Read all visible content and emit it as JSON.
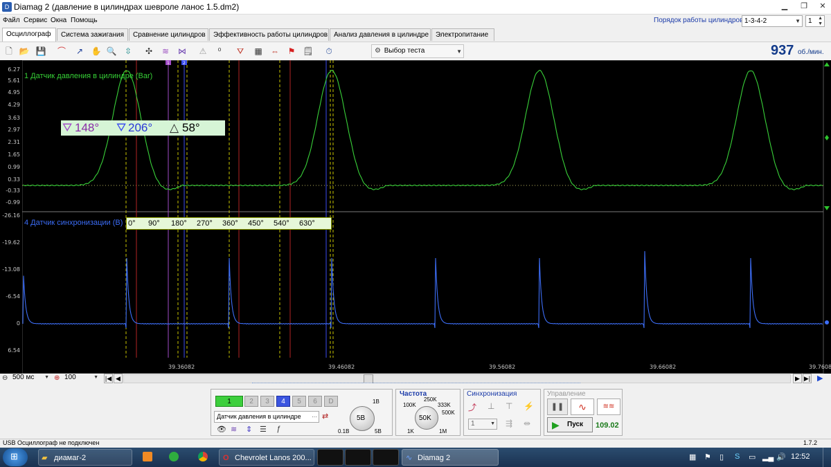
{
  "window": {
    "title": "Diamag 2 (давление в цилиндрах шевроле ланос 1.5.dm2)"
  },
  "menu": [
    "Файл",
    "Сервис",
    "Окна",
    "Помощь"
  ],
  "cylinder_order": {
    "label": "Порядок работы цилиндров",
    "value": "1-3-4-2",
    "cylinder": "1"
  },
  "tabs": [
    "Осциллограф",
    "Система зажигания",
    "Сравнение цилиндров",
    "Эффективность работы цилиндров",
    "Анализ давления в цилиндре",
    "Электропитание"
  ],
  "toolbar": {
    "test_select": "Выбор теста",
    "rpm": "937",
    "rpm_unit": "об./мин."
  },
  "scope": {
    "ch1": {
      "title": "1 Датчик давления в цилиндре (Bar)",
      "color": "#39d139",
      "ticks": [
        "6.27",
        "5.61",
        "4.95",
        "4.29",
        "3.63",
        "2.97",
        "2.31",
        "1.65",
        "0.99",
        "0.33",
        "-0.33",
        "-0.99"
      ]
    },
    "ch4": {
      "title": "4 Датчик синхронизации (B)",
      "color": "#3d6ef7",
      "ticks": [
        "-26.16",
        "-19.62",
        "-13.08",
        "-6.54",
        "0",
        "6.54"
      ]
    },
    "cursor1": "148°",
    "cursor2": "206°",
    "delta": "58°",
    "degree_scale": [
      "0°",
      "90°",
      "180°",
      "270°",
      "360°",
      "450°",
      "540°",
      "630°"
    ],
    "time_labels": [
      "39.36082",
      "39.46082",
      "39.56082",
      "39.66082",
      "39.7608"
    ]
  },
  "timebase": {
    "value": "500 мс",
    "zoom": "100"
  },
  "bottom": {
    "channels": [
      "1",
      "2",
      "3",
      "4",
      "5",
      "6",
      "D"
    ],
    "sensor": "Датчик давления в цилиндре",
    "volt": {
      "value": "5В",
      "min": "0.1В",
      "max": "5В",
      "top": "1В"
    },
    "freq": {
      "title": "Частота",
      "value": "50K",
      "l100": "100K",
      "l250": "250K",
      "l333": "333K",
      "l500": "500K",
      "l1k": "1K",
      "l1m": "1M"
    },
    "sync": {
      "title": "Синхронизация",
      "channel": "1"
    },
    "control": {
      "title": "Управление",
      "start": "Пуск",
      "value": "109.02"
    }
  },
  "status": {
    "text": "USB Осциллограф не подключен",
    "version": "1.7.2"
  },
  "taskbar": {
    "items": [
      "диамаг-2",
      "Chevrolet Lanos 200...",
      "Diamag 2"
    ],
    "time": "12:52"
  }
}
